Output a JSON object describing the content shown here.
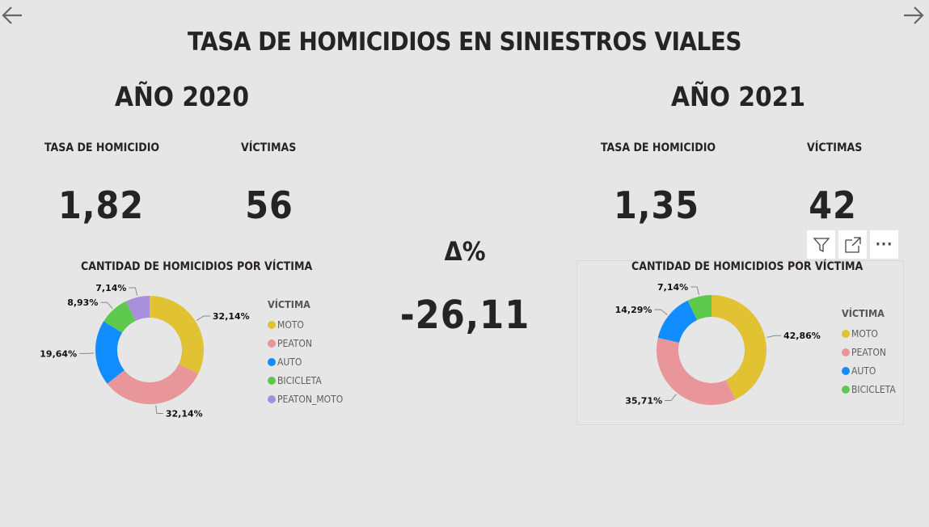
{
  "title": "TASA DE HOMICIDIOS EN SINIESTROS VIALES",
  "nav": {
    "back_icon": "arrow-left-icon",
    "forward_icon": "arrow-right-icon"
  },
  "year2020": {
    "year_label": "AÑO 2020",
    "rate_label": "TASA DE HOMICIDIO",
    "rate_value": "1,82",
    "victims_label": "VÍCTIMAS",
    "victims_value": "56",
    "chart_title": "CANTIDAD DE HOMICIDIOS POR VÍCTIMA",
    "legend_title": "VÍCTIMA"
  },
  "year2021": {
    "year_label": "AÑO 2021",
    "rate_label": "TASA DE HOMICIDIO",
    "rate_value": "1,35",
    "victims_label": "VÍCTIMAS",
    "victims_value": "42",
    "chart_title": "CANTIDAD DE HOMICIDIOS POR VÍCTIMA",
    "legend_title": "VÍCTIMA"
  },
  "delta": {
    "label": "Δ%",
    "value": "-26,11"
  },
  "toolbar": {
    "filter_icon": "filter-icon",
    "focus_icon": "focus-mode-icon",
    "more_icon": "more-options-icon",
    "more_label": "···"
  },
  "chart_data": [
    {
      "type": "pie",
      "title": "CANTIDAD DE HOMICIDIOS POR VÍCTIMA",
      "legend_title": "VÍCTIMA",
      "categories": [
        "MOTO",
        "PEATON",
        "AUTO",
        "BICICLETA",
        "PEATON_MOTO"
      ],
      "values": [
        32.14,
        32.14,
        19.64,
        8.93,
        7.14
      ],
      "labels": [
        "32,14%",
        "32,14%",
        "19,64%",
        "8,93%",
        "7,14%"
      ],
      "colors": [
        "#E1C233",
        "#E8969A",
        "#118DFF",
        "#5FC94E",
        "#A88FDB"
      ],
      "legend_position": "right"
    },
    {
      "type": "pie",
      "title": "CANTIDAD DE HOMICIDIOS POR VÍCTIMA",
      "legend_title": "VÍCTIMA",
      "categories": [
        "MOTO",
        "PEATON",
        "AUTO",
        "BICICLETA"
      ],
      "values": [
        42.86,
        35.71,
        14.29,
        7.14
      ],
      "labels": [
        "42,86%",
        "35,71%",
        "14,29%",
        "7,14%"
      ],
      "colors": [
        "#E1C233",
        "#E8969A",
        "#118DFF",
        "#5FC94E"
      ],
      "legend_position": "right"
    }
  ]
}
